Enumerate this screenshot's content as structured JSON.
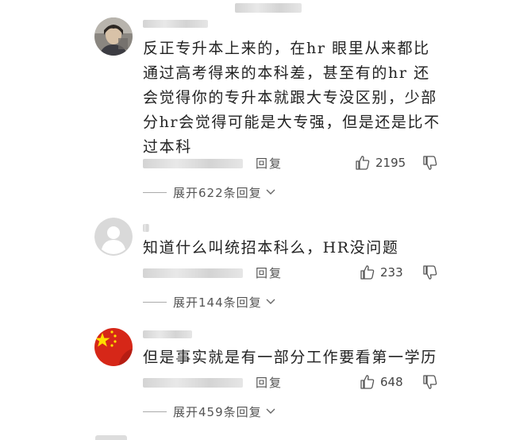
{
  "comments": [
    {
      "text": "反正专升本上来的，在hr 眼里从来都比通过高考得来的本科差，甚至有的hr 还会觉得你的专升本就跟大专没区别，少部分hr会觉得可能是大专强，但是还是比不过本科",
      "reply_label": "回复",
      "likes": "2195",
      "expand_label": "展开622条回复",
      "avatar": "photo-avatar"
    },
    {
      "text": "知道什么叫统招本科么，HR没问题",
      "reply_label": "回复",
      "likes": "233",
      "expand_label": "展开144条回复",
      "avatar": "default-avatar"
    },
    {
      "text": "但是事实就是有一部分工作要看第一学历",
      "reply_label": "回复",
      "likes": "648",
      "expand_label": "展开459条回复",
      "avatar": "flag-avatar"
    }
  ],
  "colors": {
    "text": "#222222",
    "meta": "#555555",
    "flag_red": "#d62718",
    "flag_star": "#ffde00"
  }
}
